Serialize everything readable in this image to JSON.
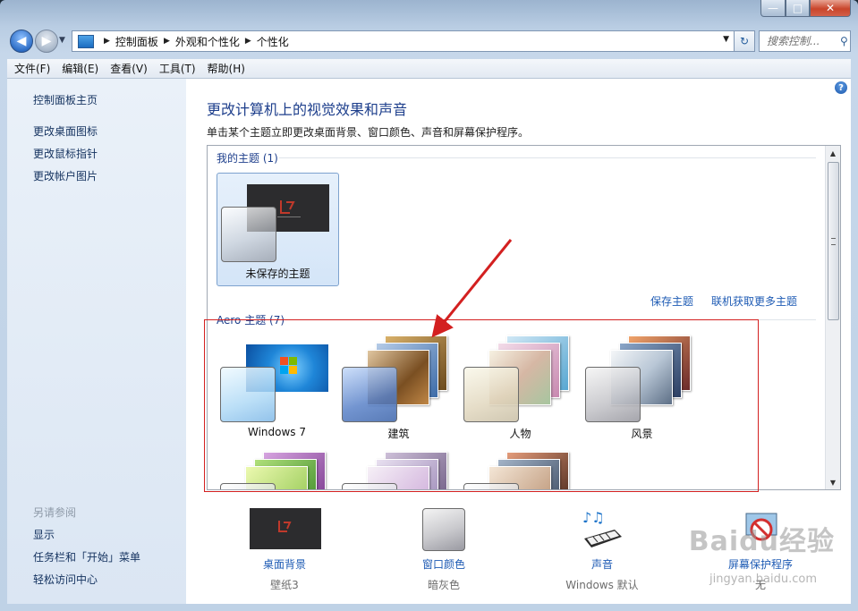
{
  "window": {
    "caption": {
      "minimize": "—",
      "maximize": "□",
      "close": "✕"
    }
  },
  "nav": {
    "back_icon": "arrow-left-icon",
    "forward_icon": "arrow-right-icon",
    "breadcrumb": [
      "控制面板",
      "外观和个性化",
      "个性化"
    ],
    "search_placeholder": "搜索控制...",
    "refresh_glyph": "↻",
    "search_glyph": "⚲"
  },
  "menu": [
    "文件(F)",
    "编辑(E)",
    "查看(V)",
    "工具(T)",
    "帮助(H)"
  ],
  "sidebar": {
    "home": "控制面板主页",
    "links": [
      "更改桌面图标",
      "更改鼠标指针",
      "更改帐户图片"
    ],
    "see_also": "另请参阅",
    "see_also_links": [
      "显示",
      "任务栏和「开始」菜单",
      "轻松访问中心"
    ]
  },
  "main": {
    "title": "更改计算机上的视觉效果和声音",
    "description": "单击某个主题立即更改桌面背景、窗口颜色、声音和屏幕保护程序。",
    "help_glyph": "?",
    "my_themes": {
      "header": "我的主题 (1)",
      "items": [
        {
          "label": "未保存的主题"
        }
      ]
    },
    "save_theme": "保存主题",
    "more_themes": "联机获取更多主题",
    "aero": {
      "header": "Aero 主题 (7)",
      "items": [
        {
          "label": "Windows 7"
        },
        {
          "label": "建筑"
        },
        {
          "label": "人物"
        },
        {
          "label": "风景"
        }
      ]
    }
  },
  "bottom": [
    {
      "label": "桌面背景",
      "value": "壁纸3"
    },
    {
      "label": "窗口颜色",
      "value": "暗灰色"
    },
    {
      "label": "声音",
      "value": "Windows 默认"
    },
    {
      "label": "屏幕保护程序",
      "value": "无"
    }
  ],
  "watermark": {
    "main": "Baidu经验",
    "sub": "jingyan.baidu.com"
  },
  "colors": {
    "link": "#1e5bb4",
    "title": "#1e3f8c",
    "annotation": "#d32020"
  }
}
